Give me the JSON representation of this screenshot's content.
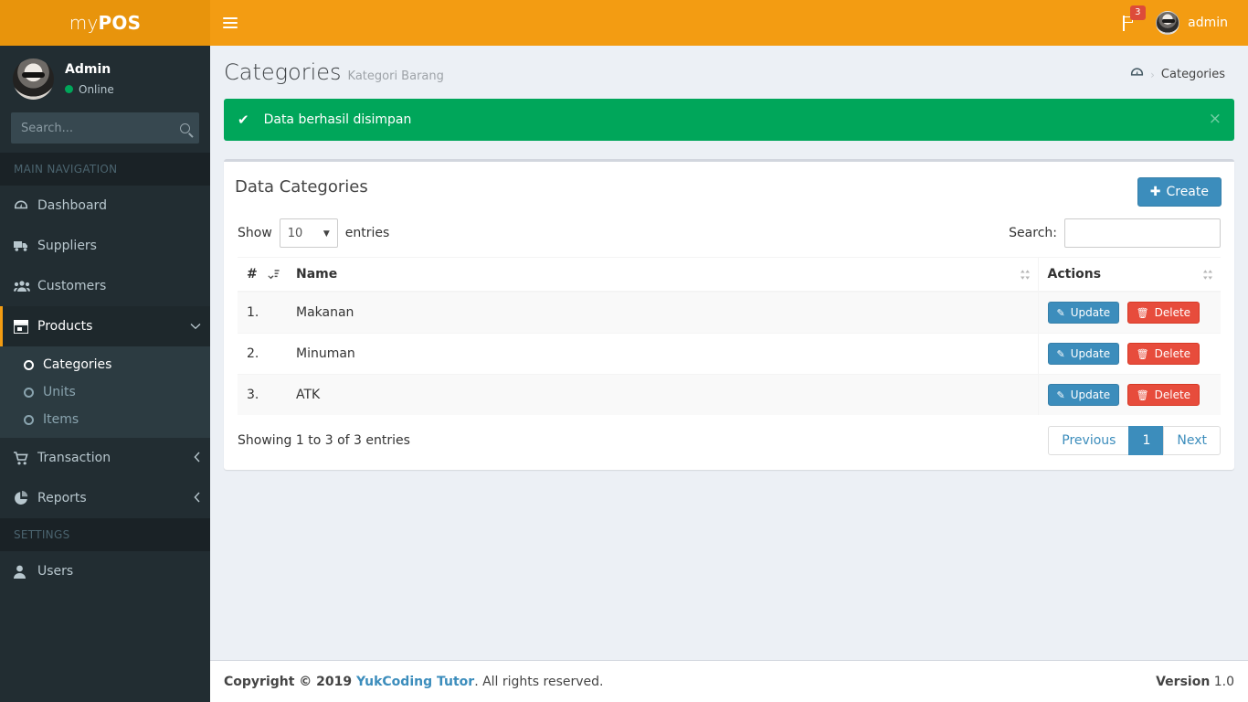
{
  "brand": {
    "prefix": "my",
    "suffix": "POS"
  },
  "header": {
    "toggle_label": "Toggle navigation",
    "notifications_count": "3",
    "user_name": "admin"
  },
  "sidebar": {
    "user": {
      "name": "Admin",
      "status": "Online"
    },
    "search": {
      "placeholder": "Search...",
      "value": ""
    },
    "sections": [
      {
        "title": "MAIN NAVIGATION"
      },
      {
        "title": "SETTINGS"
      }
    ],
    "items": [
      {
        "label": "Dashboard",
        "icon": "dashboard-icon"
      },
      {
        "label": "Suppliers",
        "icon": "truck-icon"
      },
      {
        "label": "Customers",
        "icon": "users-icon"
      },
      {
        "label": "Products",
        "icon": "box-icon",
        "caret": "⌄"
      },
      {
        "label": "Transaction",
        "icon": "cart-icon",
        "caret": "‹"
      },
      {
        "label": "Reports",
        "icon": "pie-chart-icon",
        "caret": "‹"
      },
      {
        "label": "Users",
        "icon": "user-icon"
      }
    ],
    "products_submenu": [
      {
        "label": "Categories"
      },
      {
        "label": "Units"
      },
      {
        "label": "Items"
      }
    ]
  },
  "page": {
    "title": "Categories",
    "subtitle": "Kategori Barang",
    "breadcrumb_current": "Categories",
    "breadcrumb_sep": "›"
  },
  "alert": {
    "check": "✔",
    "message": "Data berhasil disimpan",
    "close": "×"
  },
  "box": {
    "title": "Data Categories",
    "create_label": "Create",
    "create_plus": "✚"
  },
  "datatable": {
    "show_label": "Show",
    "entries_label": "entries",
    "page_length": "10",
    "length_arrow": "▼",
    "search_label": "Search:",
    "search_value": "",
    "columns": [
      "#",
      "Name",
      "Actions"
    ],
    "sort_icon_num": "↓≡",
    "sort_icon_both": "⇅",
    "rows": [
      {
        "num": "1.",
        "name": "Makanan"
      },
      {
        "num": "2.",
        "name": "Minuman"
      },
      {
        "num": "3.",
        "name": "ATK"
      }
    ],
    "update_label": "Update",
    "delete_label": "Delete",
    "update_icon": "✎",
    "delete_icon": "🗑",
    "info": "Showing 1 to 3 of 3 entries",
    "pagination": {
      "previous": "Previous",
      "current_page": "1",
      "next": "Next"
    }
  },
  "footer": {
    "copyright_prefix": "Copyright © 2019 ",
    "company": "YukCoding Tutor",
    "copyright_suffix": ". All rights reserved.",
    "version_label": "Version",
    "version_value": "1.0"
  },
  "colors": {
    "brand_orange": "#f39c12",
    "logo_orange": "#e8940c",
    "sidebar_dark": "#222d32",
    "success_green": "#00a65a",
    "primary_blue": "#3c8dbc",
    "danger_red": "#e74c3c"
  }
}
